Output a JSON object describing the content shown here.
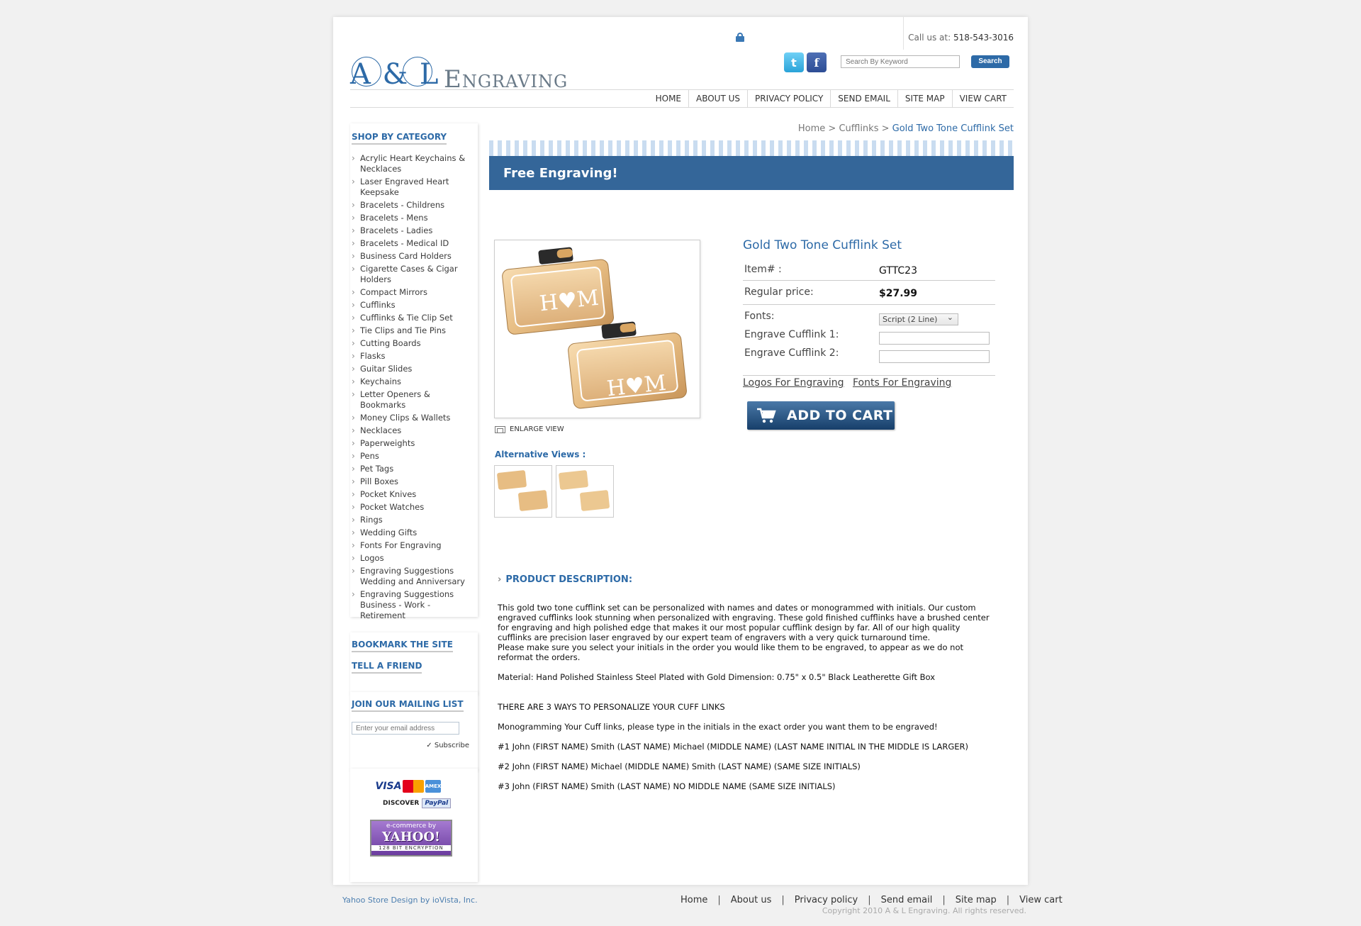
{
  "header": {
    "logo_primary": "A & L",
    "logo_secondary": "Engraving",
    "call_label": "Call us at:",
    "phone": "518-543-3016",
    "search_placeholder": "Search By Keyword",
    "search_button": "Search",
    "twitter_icon": "t",
    "facebook_icon": "f"
  },
  "topnav": [
    "HOME",
    "ABOUT US",
    "PRIVACY POLICY",
    "SEND EMAIL",
    "SITE MAP",
    "VIEW CART"
  ],
  "sidebar": {
    "category_title": "SHOP BY CATEGORY",
    "categories": [
      "Acrylic Heart Keychains & Necklaces",
      "Laser Engraved Heart Keepsake",
      "Bracelets - Childrens",
      "Bracelets - Mens",
      "Bracelets - Ladies",
      "Bracelets - Medical ID",
      "Business Card Holders",
      "Cigarette Cases & Cigar Holders",
      "Compact Mirrors",
      "Cufflinks",
      "Cufflinks & Tie Clip Set",
      "Tie Clips and Tie Pins",
      "Cutting Boards",
      "Flasks",
      "Guitar Slides",
      "Keychains",
      "Letter Openers & Bookmarks",
      "Money Clips & Wallets",
      "Necklaces",
      "Paperweights",
      "Pens",
      "Pet Tags",
      "Pill Boxes",
      "Pocket Knives",
      "Pocket Watches",
      "Rings",
      "Wedding Gifts",
      "Fonts For Engraving",
      "Logos",
      "Engraving Suggestions Wedding and Anniversary",
      "Engraving Suggestions Business - Work - Retirement"
    ],
    "bookmark": "BOOKMARK THE SITE",
    "tell_friend": "TELL A FRIEND",
    "mailing_title": "JOIN OUR MAILING LIST",
    "email_placeholder": "Enter your email address",
    "subscribe": "Subscribe",
    "cards": {
      "visa": "VISA",
      "mastercard": "MasterCard",
      "amex": "AMEX",
      "discover": "DISCOVER",
      "paypal": "PayPal"
    },
    "yahoo": {
      "line1": "e-commerce by",
      "line2": "YAHOO!",
      "line3": "128 BIT ENCRYPTION"
    }
  },
  "breadcrumb": {
    "home": "Home",
    "sep": " > ",
    "category": "Cufflinks",
    "current": "Gold Two Tone Cufflink Set"
  },
  "banner": "Free Engraving!",
  "product": {
    "title": "Gold Two Tone Cufflink Set",
    "item_label": "Item# :",
    "item_value": "GTTC23",
    "price_label": "Regular price:",
    "price_value": "$27.99",
    "fonts_label": "Fonts:",
    "font_selected": "Script (2 Line)",
    "engrave1_label": "Engrave Cufflink 1:",
    "engrave2_label": "Engrave Cufflink 2:",
    "link_logos": "Logos For Engraving",
    "link_fonts": "Fonts For Engraving",
    "add_to_cart": "ADD TO CART",
    "enlarge": "ENLARGE VIEW",
    "alt_views": "Alternative Views :",
    "monogram": "H♥M"
  },
  "description": {
    "title": "PRODUCT DESCRIPTION:",
    "p1": "This gold two tone cufflink set can be personalized with names and dates or monogrammed with initials. Our custom engraved cufflinks look stunning when personalized with engraving. These gold finished cufflinks have a brushed center for engraving and high polished edge that makes it our most popular cufflink design by far. All of our high quality cufflinks are precision laser engraved by our expert team of engravers with a very quick turnaround time.",
    "p2": "Please make sure you select your initials in the order you would like them to be engraved, to appear as we do not reformat the orders.",
    "p3": "Material: Hand Polished Stainless Steel Plated with Gold Dimension: 0.75\" x 0.5\" Black Leatherette Gift Box",
    "p4": "THERE ARE 3 WAYS TO PERSONALIZE YOUR CUFF LINKS",
    "p5": "Monogramming Your Cuff links, please type in the initials in the exact order you want them to be engraved!",
    "p6": "#1 John (FIRST NAME) Smith (LAST NAME) Michael (MIDDLE NAME) (LAST NAME INITIAL IN THE MIDDLE IS LARGER)",
    "p7": "#2 John (FIRST NAME) Michael (MIDDLE NAME) Smith (LAST NAME) (SAME SIZE INITIALS)",
    "p8": "#3 John (FIRST NAME) Smith (LAST NAME) NO MIDDLE NAME (SAME SIZE INITIALS)"
  },
  "footer": {
    "credit": "Yahoo Store Design by ioVista, Inc.",
    "nav": [
      "Home",
      "About us",
      "Privacy policy",
      "Send email",
      "Site map",
      "View cart"
    ],
    "sep": "|",
    "copyright": "Copyright 2010 A & L Engraving. All rights reserved."
  }
}
